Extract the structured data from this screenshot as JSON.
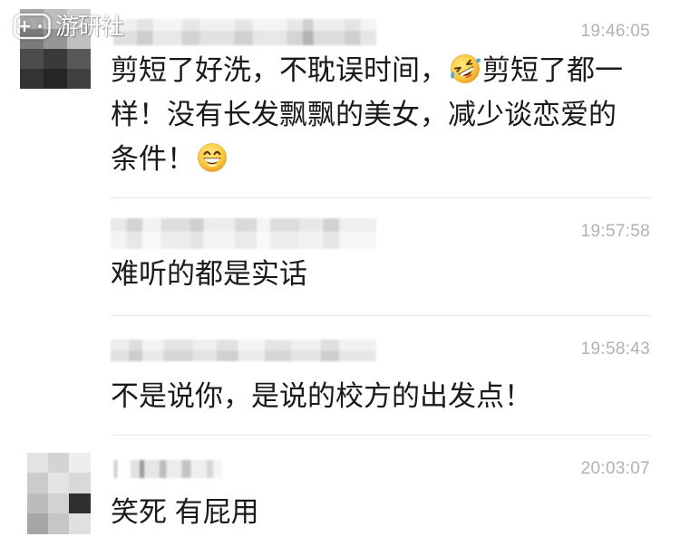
{
  "colors": {
    "background": "#ffffff",
    "message_text": "#1a1a1a",
    "timestamp": "#b2b2b2",
    "divider": "#e8e8e8",
    "watermark": "#ffffff"
  },
  "watermark": {
    "icon": "gamepad-logo-icon",
    "text": "游研社"
  },
  "messages": [
    {
      "time": "19:46:05",
      "lines": [
        [
          {
            "text": "剪短了好洗，不耽误时间，"
          },
          {
            "icon": "rolling-on-the-floor-laughing-emoji-icon"
          },
          {
            "text": "剪短了都一"
          }
        ],
        [
          {
            "text": "样！没有长发飘飘的美女，减少谈恋爱的"
          }
        ],
        [
          {
            "text": "条件！"
          },
          {
            "icon": "grinning-emoji-icon"
          }
        ]
      ]
    },
    {
      "time": "19:57:58",
      "lines": [
        [
          {
            "text": "难听的都是实话"
          }
        ]
      ]
    },
    {
      "time": "19:58:43",
      "lines": [
        [
          {
            "text": "不是说你，是说的校方的出发点！"
          }
        ]
      ]
    },
    {
      "time": "20:03:07",
      "lines": [
        [
          {
            "text": "笑死 有屁用"
          }
        ]
      ]
    }
  ]
}
